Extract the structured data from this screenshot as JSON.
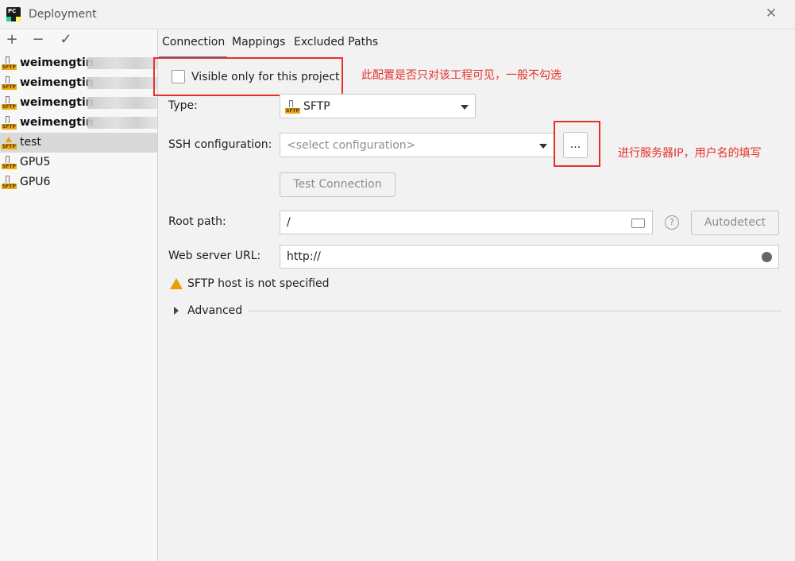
{
  "window": {
    "title": "Deployment",
    "close_icon": "✕"
  },
  "toolbar": {
    "add": "+",
    "remove": "−",
    "apply": "✓"
  },
  "servers": [
    {
      "label": "weimengtin",
      "bold": true
    },
    {
      "label": "weimengtin",
      "bold": true
    },
    {
      "label": "weimengtin",
      "bold": true
    },
    {
      "label": "weimengtin",
      "bold": true
    },
    {
      "label": "test",
      "selected": true,
      "warning": true
    },
    {
      "label": "GPU5"
    },
    {
      "label": "GPU6"
    }
  ],
  "sftp_badge": "SFTP",
  "tabs": [
    {
      "label": "Connection",
      "active": true
    },
    {
      "label": "Mappings"
    },
    {
      "label": "Excluded Paths"
    }
  ],
  "form": {
    "visible_only": "Visible only for this project",
    "type_label": "Type:",
    "type_value": "SFTP",
    "ssh_label": "SSH configuration:",
    "ssh_placeholder": "<select configuration>",
    "ellipsis": "...",
    "test_connection": "Test Connection",
    "root_label": "Root path:",
    "root_value": "/",
    "help": "?",
    "autodetect": "Autodetect",
    "web_label": "Web server URL:",
    "web_value": "http://",
    "warning": "SFTP host is not specified",
    "advanced": "Advanced"
  },
  "annotations": {
    "visible_note": "此配置是否只对该工程可见，一般不勾选",
    "ssh_note": "进行服务器IP，用户名的填写"
  },
  "colors": {
    "annotation": "#e5302a",
    "tab_underline": "#4083c9",
    "sftp": "#e6a817"
  }
}
